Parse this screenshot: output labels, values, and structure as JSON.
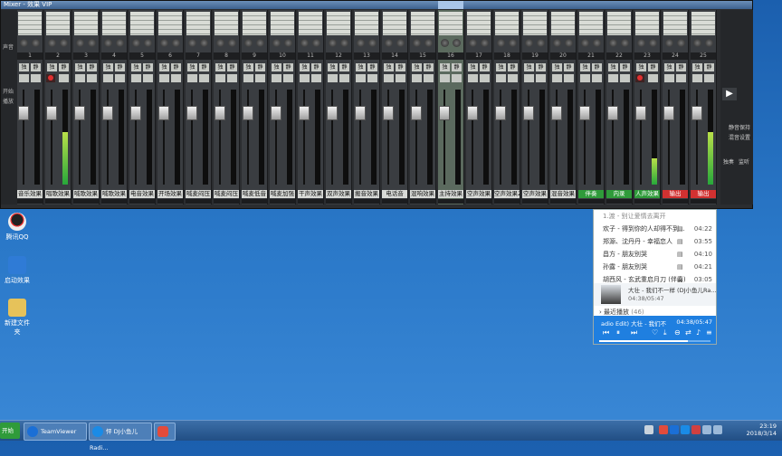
{
  "mixer": {
    "title": "Mixer - 效果 VIP",
    "left_labels": [
      "声音",
      "开始",
      "播放"
    ],
    "send_label": "辅助",
    "eq_label": "均衡器",
    "solo_label": "独",
    "mute_label": "静",
    "channel_numbers": [
      "1",
      "2",
      "3",
      "4",
      "5",
      "6",
      "7",
      "8",
      "9",
      "10",
      "11",
      "12",
      "13",
      "14",
      "15",
      "16",
      "17",
      "18",
      "19",
      "20",
      "21",
      "22",
      "23",
      "24",
      "25"
    ],
    "channel_names": [
      "音乐效果",
      "唱歌效果",
      "喊歌效果",
      "喊歌效果",
      "电音效果",
      "开场效果",
      "喊麦闷压",
      "喊麦闷压",
      "喊麦低音",
      "喊麦加强",
      "干声效果",
      "双声效果",
      "搬音效果",
      "电话音",
      "混响效果",
      "主持效果",
      "空声效果",
      "空声效果2",
      "空声效果",
      "混音效果",
      "伴奏",
      "内录",
      "人声效果",
      "输出",
      "输出"
    ],
    "right_labels": {
      "solo_safe": "静音保持",
      "dim": "混音设置",
      "pan": "独奏",
      "level": "监听"
    }
  },
  "desktop_icons": [
    {
      "label": "腾讯QQ",
      "color": "#e9e9e9"
    },
    {
      "label": "启动效果",
      "color": "#2f7bd6"
    },
    {
      "label": "新建文件夹",
      "color": "#e6c25a"
    }
  ],
  "player": {
    "header": "1.渡 - 别让爱情去离开",
    "songs": [
      {
        "title": "欢子 - 得到你的人却得不到...",
        "time": "04:22"
      },
      {
        "title": "郑源、沈丹丹 - 幸福恋人",
        "time": "03:55"
      },
      {
        "title": "昌方 - 朋友别哭",
        "time": "04:10"
      },
      {
        "title": "孙露 - 朋友别哭",
        "time": "04:21"
      },
      {
        "title": "胡西风 - 玄武重启月刀 (伴奏)",
        "time": "03:05"
      }
    ],
    "now_playing_title": "大壮 - 我们不一样 (DJ小鱼儿Ra...",
    "now_playing_time": "04:38/05:47",
    "recent_label": "最近播放",
    "recent_count": "(46)",
    "bar_song": "adio Edit)    大壮 - 我们不",
    "bar_time": "04:38/05:47",
    "progress": 0.8
  },
  "taskbar": {
    "start_label": "开始",
    "tasks": [
      "TeamViewer",
      "怦 DJ小鱼儿Radi..."
    ],
    "clock_time": "23:19",
    "clock_date": "2018/3/14"
  }
}
